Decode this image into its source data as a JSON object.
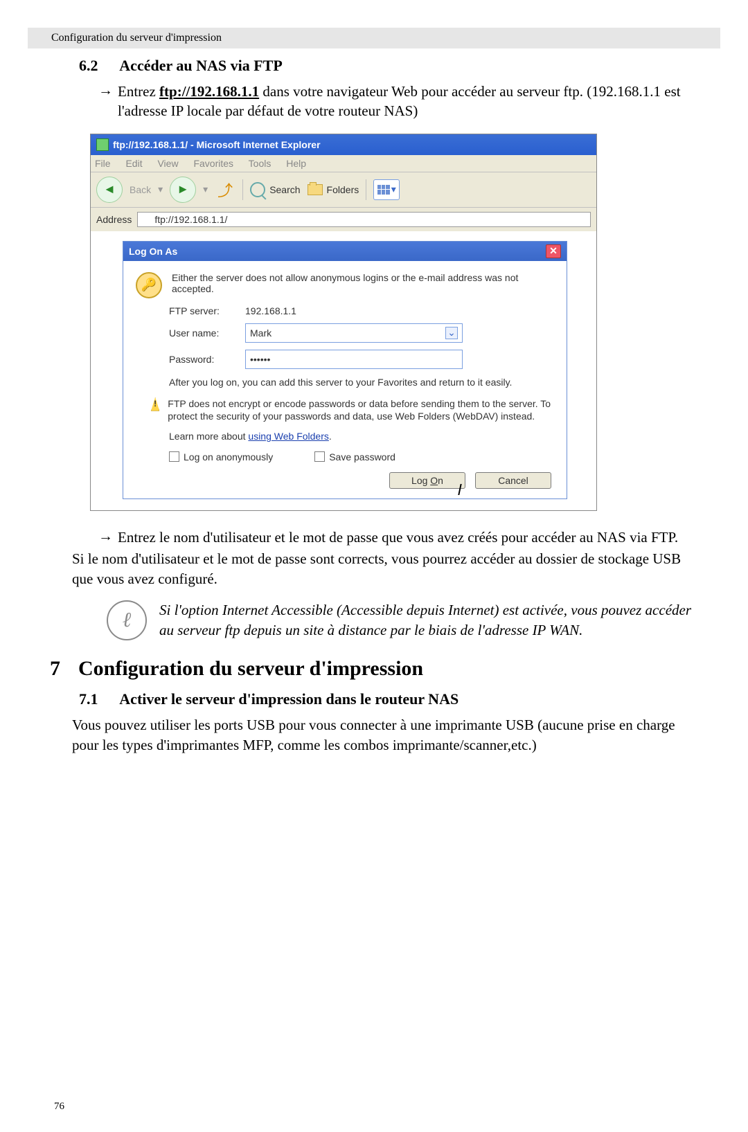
{
  "running_head": "Configuration du serveur d'impression",
  "sec62": {
    "num": "6.2",
    "title": "Accéder au NAS via FTP"
  },
  "bullet1_pre": "Entrez ",
  "bullet1_link": "ftp://192.168.1.1",
  "bullet1_post": " dans votre navigateur Web pour accéder au serveur ftp. (192.168.1.1 est l'adresse IP locale par défaut de votre routeur NAS)",
  "ie": {
    "title": "ftp://192.168.1.1/ - Microsoft Internet Explorer",
    "menu": {
      "file": "File",
      "edit": "Edit",
      "view": "View",
      "fav": "Favorites",
      "tools": "Tools",
      "help": "Help"
    },
    "back": "Back",
    "search": "Search",
    "folders": "Folders",
    "addr_label": "Address",
    "addr_value": "ftp://192.168.1.1/"
  },
  "dlg": {
    "title": "Log On As",
    "msg": "Either the server does not allow anonymous logins or the e-mail address was not accepted.",
    "ftp_label": "FTP server:",
    "ftp_value": "192.168.1.1",
    "user_label": "User name:",
    "user_value": "Mark",
    "pass_label": "Password:",
    "pass_value": "••••••",
    "fav": "After you log on, you can add this server to your Favorites and return to it easily.",
    "warn": "FTP does not encrypt or encode passwords or data before sending them to the server.  To protect the security of your passwords and data, use Web Folders (WebDAV) instead.",
    "learn_pre": "Learn more about ",
    "learn_link": "using Web Folders",
    "anon": "Log on anonymously",
    "save": "Save password",
    "logon_pre": "Log ",
    "logon_u": "O",
    "logon_post": "n",
    "cancel": "Cancel"
  },
  "bullet2": "Entrez le nom d'utilisateur et le mot de passe que vous avez créés pour accéder au NAS via FTP.",
  "para1": "Si le nom d'utilisateur et le mot de passe sont corrects, vous pourrez accéder au dossier de stockage USB que vous avez configuré.",
  "note": "Si l'option Internet Accessible (Accessible depuis Internet) est activée, vous pouvez accéder au serveur ftp depuis un site à distance par le biais de l'adresse IP WAN.",
  "h7": {
    "num": "7",
    "title": "Configuration du serveur d'impression"
  },
  "sec71": {
    "num": "7.1",
    "title": "Activer le serveur d'impression dans le routeur NAS"
  },
  "para2": "Vous pouvez utiliser les ports USB pour vous connecter à une imprimante USB (aucune prise en charge pour les types d'imprimantes MFP, comme les combos imprimante/scanner,etc.)",
  "page_number": "76",
  "arrow_glyph": "→",
  "dot": "."
}
